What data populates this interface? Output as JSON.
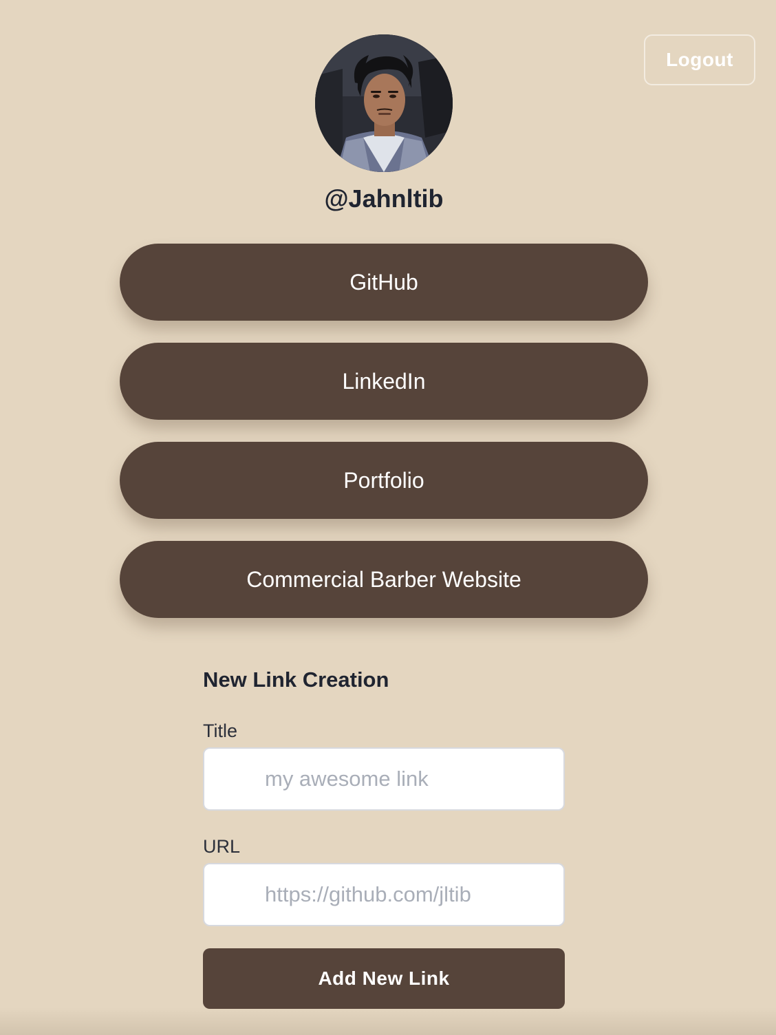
{
  "header": {
    "logout_label": "Logout"
  },
  "profile": {
    "avatar_icon": "profile-photo",
    "username": "@Jahnltib"
  },
  "links": [
    {
      "label": "GitHub"
    },
    {
      "label": "LinkedIn"
    },
    {
      "label": "Portfolio"
    },
    {
      "label": "Commercial Barber Website"
    }
  ],
  "form": {
    "heading": "New Link Creation",
    "title_label": "Title",
    "title_value": "",
    "title_placeholder": "my awesome link",
    "url_label": "URL",
    "url_value": "",
    "url_placeholder": "https://github.com/jltib",
    "submit_label": "Add New Link"
  },
  "colors": {
    "background": "#e4d6c0",
    "pill": "#56443a",
    "text_dark": "#1f2430"
  }
}
